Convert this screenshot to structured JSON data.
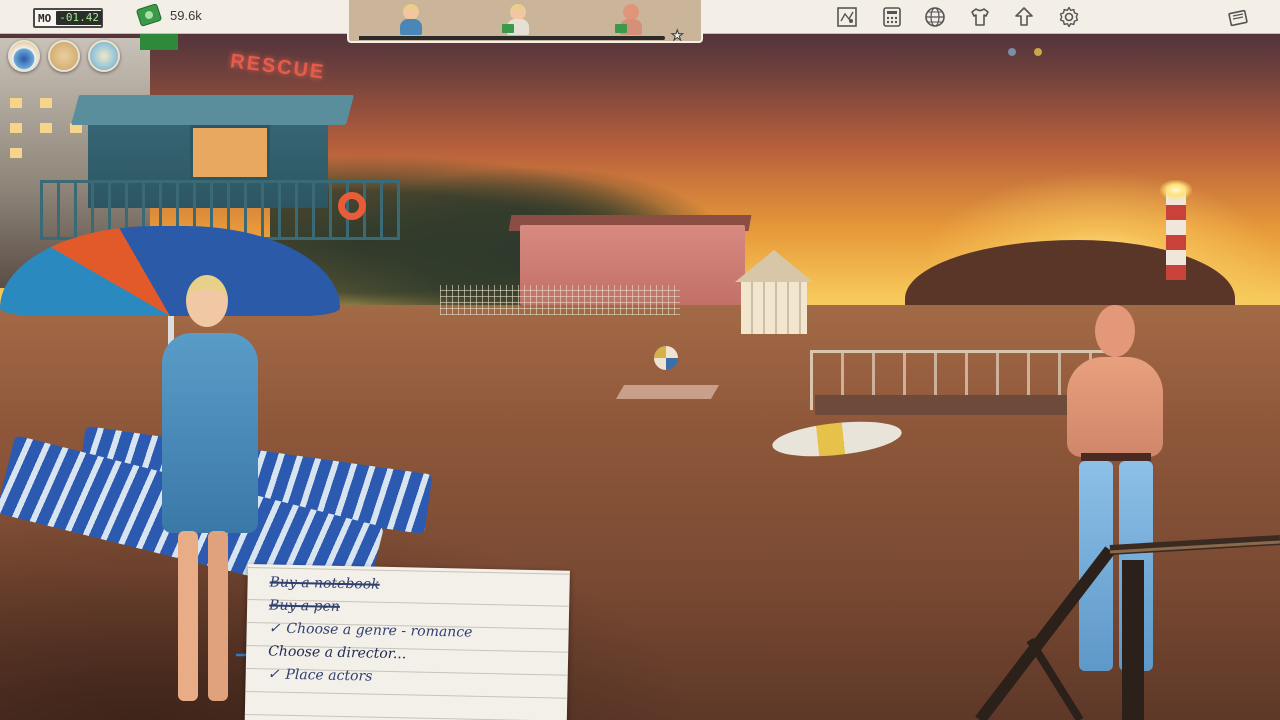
{
  "topbar": {
    "month_label": "MO",
    "month_counter": "-01.42",
    "money": "59.6k",
    "icons": [
      "map-icon",
      "calculator-icon",
      "globe-icon",
      "tshirt-icon",
      "upload-arrow-icon",
      "settings-gear-icon",
      "notes-icon"
    ]
  },
  "cast_panel": {
    "slots": [
      {
        "name": "actress-one",
        "hair": "#e8cf8a",
        "skin": "#f1c6a0",
        "shirt": "#4a86b6",
        "badge": false
      },
      {
        "name": "actress-two",
        "hair": "#e8cf8a",
        "skin": "#f1c6a0",
        "shirt": "#e6e0d4",
        "badge": true
      },
      {
        "name": "actor",
        "hair": "#d6907a",
        "skin": "#e0957a",
        "shirt": "#d6907a",
        "badge": true
      }
    ],
    "progress": 0.98
  },
  "location_buttons": [
    "beach-location-icon",
    "sand-location-icon",
    "sea-location-icon"
  ],
  "scene": {
    "sign": "RESCUE"
  },
  "tasks": [
    {
      "text": "Buy a notebook",
      "state": "done"
    },
    {
      "text": "Buy a pen",
      "state": "done"
    },
    {
      "text": "Choose a genre - romance",
      "state": "checked",
      "check": "✓"
    },
    {
      "text": "Choose a director...",
      "state": "current"
    },
    {
      "text": "Place actors",
      "state": "checked",
      "check": "✓"
    }
  ],
  "colors": {
    "topbar_bg": "#f4efe6",
    "task_ink": "#2f3f6e",
    "arrow": "#2a7ac8"
  }
}
